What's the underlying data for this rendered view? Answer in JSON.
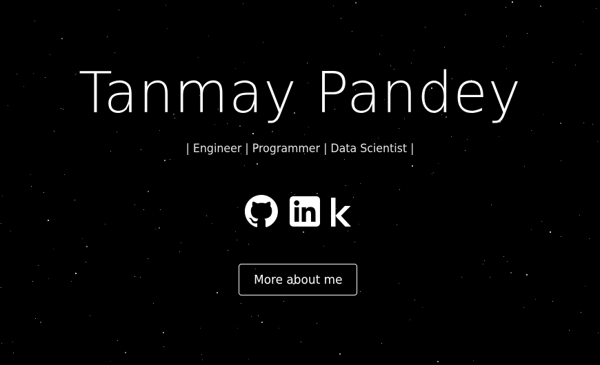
{
  "hero": {
    "name": "Tanmay Pandey",
    "tagline": "| Engineer | Programmer | Data Scientist |"
  },
  "socials": [
    {
      "icon": "github-icon",
      "label": "GitHub"
    },
    {
      "icon": "linkedin-icon",
      "label": "LinkedIn"
    },
    {
      "icon": "kaggle-icon",
      "label": "Kaggle"
    }
  ],
  "cta": {
    "label": "More about me"
  },
  "colors": {
    "background": "#000000",
    "foreground": "#ffffff",
    "star": "#ffffff"
  }
}
